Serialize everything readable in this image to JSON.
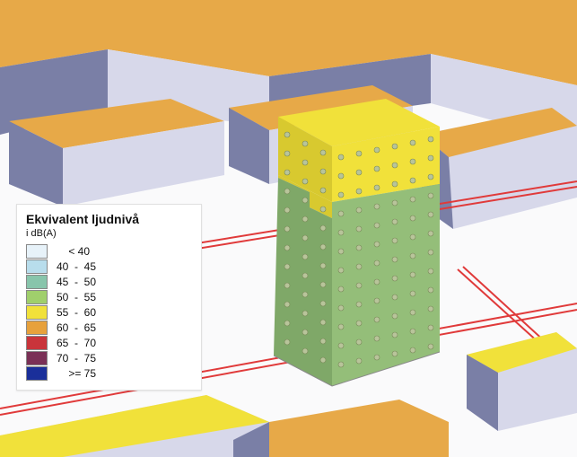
{
  "legend": {
    "title": "Ekvivalent ljudnivå",
    "subtitle": "i dB(A)",
    "rows": [
      {
        "color": "#e7f2f9",
        "label": "    < 40"
      },
      {
        "color": "#b8ddec",
        "label": "40  -  45"
      },
      {
        "color": "#88c5ab",
        "label": "45  -  50"
      },
      {
        "color": "#a0cf6c",
        "label": "50  -  55"
      },
      {
        "color": "#f1e13a",
        "label": "55  -  60"
      },
      {
        "color": "#e7a13c",
        "label": "60  -  65"
      },
      {
        "color": "#c9343b",
        "label": "65  -  70"
      },
      {
        "color": "#7a3056",
        "label": "70  -  75"
      },
      {
        "color": "#1a2f9a",
        "label": "    >= 75"
      }
    ]
  },
  "colors": {
    "ground": "#fafafb",
    "wall_shadow": "#7a7fa6",
    "wall_light": "#d7d8ea",
    "roof_orange": "#e7a948",
    "roof_yellow": "#f1e13a",
    "road_line": "#e03a3a",
    "tower_green": "#94be79",
    "tower_green_dark": "#7fa868",
    "tower_yellow": "#f1e13a",
    "tower_yellow_dark": "#d8c92f",
    "dot": "#b8c49a"
  },
  "chart_data": {
    "type": "heatmap",
    "title": "Ekvivalent ljudnivå i dB(A)",
    "unit": "dB(A)",
    "bins": [
      {
        "min": null,
        "max": 40,
        "color": "#e7f2f9"
      },
      {
        "min": 40,
        "max": 45,
        "color": "#b8ddec"
      },
      {
        "min": 45,
        "max": 50,
        "color": "#88c5ab"
      },
      {
        "min": 50,
        "max": 55,
        "color": "#a0cf6c"
      },
      {
        "min": 55,
        "max": 60,
        "color": "#f1e13a"
      },
      {
        "min": 60,
        "max": 65,
        "color": "#e7a13c"
      },
      {
        "min": 65,
        "max": 70,
        "color": "#c9343b"
      },
      {
        "min": 70,
        "max": 75,
        "color": "#7a3056"
      },
      {
        "min": 75,
        "max": null,
        "color": "#1a2f9a"
      }
    ],
    "central_building_facade_levels": {
      "upper_floors": "55-60",
      "lower_floors": "50-55"
    }
  }
}
